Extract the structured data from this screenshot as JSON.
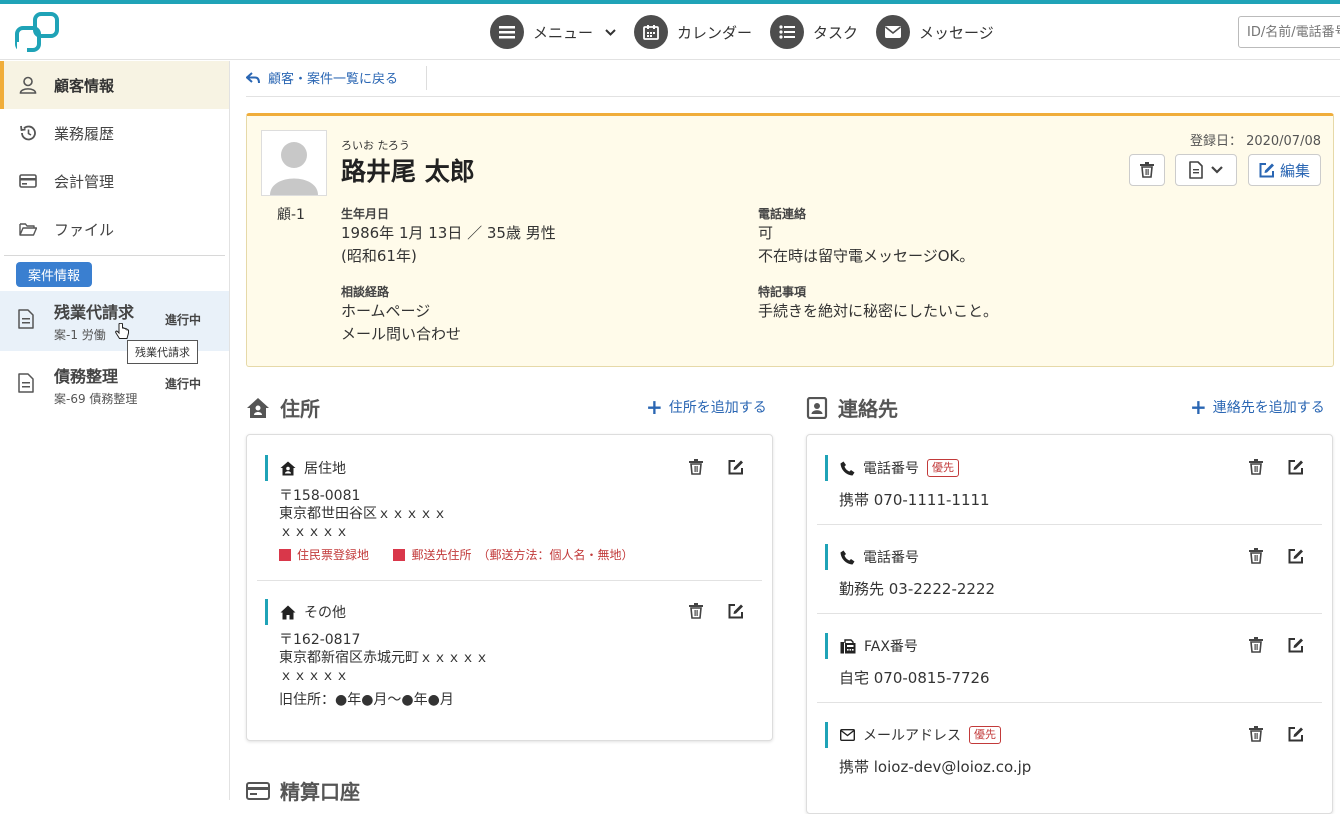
{
  "header": {
    "nav": [
      {
        "label": "メニュー",
        "icon": "menu-icon"
      },
      {
        "label": "カレンダー",
        "icon": "calendar-icon"
      },
      {
        "label": "タスク",
        "icon": "task-list-icon"
      },
      {
        "label": "メッセージ",
        "icon": "envelope-icon"
      }
    ],
    "search_placeholder": "ID/名前/電話番号"
  },
  "sidebar": {
    "items": [
      {
        "label": "顧客情報",
        "icon": "person-icon",
        "active": true
      },
      {
        "label": "業務履歴",
        "icon": "history-icon"
      },
      {
        "label": "会計管理",
        "icon": "credit-card-icon"
      },
      {
        "label": "ファイル",
        "icon": "folder-icon"
      }
    ],
    "case_badge": "案件情報",
    "cases": [
      {
        "title": "残業代請求",
        "sub": "案-1 労働",
        "status": "進行中"
      },
      {
        "title": "債務整理",
        "sub": "案-69 債務整理",
        "status": "進行中"
      }
    ],
    "tooltip": "残業代請求"
  },
  "main": {
    "back_label": "顧客・案件一覧に戻る",
    "profile": {
      "customer_id": "顧-1",
      "kana": "ろいお たろう",
      "name": "路井尾 太郎",
      "registered": "登録日： 2020/07/08",
      "edit_label": "編集",
      "birth_label": "生年月日",
      "birth_line1": "1986年 1月 13日 ／ 35歳 男性",
      "birth_line2": "(昭和61年)",
      "phone_label": "電話連絡",
      "phone_line1": "可",
      "phone_line2": "不在時は留守電メッセージOK。",
      "route_label": "相談経路",
      "route_line1": "ホームページ",
      "route_line2": "メール問い合わせ",
      "note_label": "特記事項",
      "note_line1": "手続きを絶対に秘密にしたいこと。"
    },
    "address": {
      "title": "住所",
      "add_label": "住所を追加する",
      "entries": [
        {
          "type": "居住地",
          "postal": "〒158-0081",
          "line1": "東京都世田谷区ｘｘｘｘｘ",
          "line2": "ｘｘｘｘｘ",
          "tag1": "住民票登録地",
          "tag2": "郵送先住所",
          "tag2_note": "（郵送方法：個人名・無地）"
        },
        {
          "type": "その他",
          "postal": "〒162-0817",
          "line1": "東京都新宿区赤城元町ｘｘｘｘｘ",
          "line2": "ｘｘｘｘｘ",
          "note": "旧住所：●年●月～●年●月"
        }
      ]
    },
    "contact": {
      "title": "連絡先",
      "add_label": "連絡先を追加する",
      "entries": [
        {
          "type": "電話番号",
          "priority": "優先",
          "value": "携帯 070-1111-1111",
          "icon": "phone-icon"
        },
        {
          "type": "電話番号",
          "value": "勤務先 03-2222-2222",
          "icon": "phone-icon"
        },
        {
          "type": "FAX番号",
          "value": "自宅 070-0815-7726",
          "icon": "fax-icon"
        },
        {
          "type": "メールアドレス",
          "priority": "優先",
          "value": "携帯 loioz-dev@loioz.co.jp",
          "icon": "mail-icon"
        }
      ]
    },
    "account": {
      "title": "精算口座"
    }
  },
  "colors": {
    "accent": "#1fa3b7",
    "link": "#2a66b3",
    "highlight": "#f0ad3a",
    "priority": "#c23a3a"
  }
}
